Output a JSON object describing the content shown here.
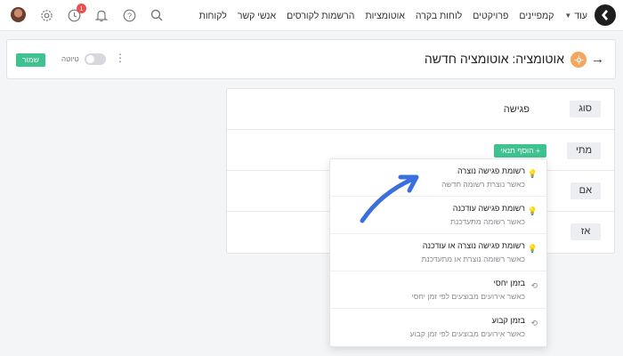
{
  "nav": {
    "items": [
      "לקוחות",
      "אנשי קשר",
      "הרשמות לקורסים",
      "אוטומציות",
      "לוחות בקרה",
      "פרויקטים",
      "קמפיינים"
    ],
    "more_label": "עוד",
    "notification_count": "1"
  },
  "header": {
    "title": "אוטומציה: אוטומציה חדשה",
    "draft_label": "טיוטה",
    "save_label": "שמור"
  },
  "rules": {
    "type_label": "סוג",
    "type_value": "פגישה",
    "when_label": "מתי",
    "add_condition_label": "הוסף תנאי",
    "if_label": "אם",
    "then_label": "אז"
  },
  "dropdown": {
    "items": [
      {
        "title": "רשומת פגישה נוצרה",
        "desc": "כאשר נוצרת רשומה חדשה",
        "icon": "bulb-icon"
      },
      {
        "title": "רשומת פגישה עודכנה",
        "desc": "כאשר רשומה מתעדכנת",
        "icon": "bulb-icon"
      },
      {
        "title": "רשומת פגישה נוצרה או עודכנה",
        "desc": "כאשר רשומה נוצרת או מתעדכנת",
        "icon": "bulb-icon"
      },
      {
        "title": "בזמן יחסי",
        "desc": "כאשר אירועים מבוצעים לפי זמן יחסי",
        "icon": "history-icon"
      },
      {
        "title": "בזמן קבוע",
        "desc": "כאשר אירועים מבוצעים לפי זמן קבוע",
        "icon": "history-icon"
      }
    ]
  },
  "colors": {
    "accent": "#3ec28f",
    "arrow": "#3b6fe0",
    "badge": "#e8514d",
    "automation_icon": "#f5a55c"
  }
}
